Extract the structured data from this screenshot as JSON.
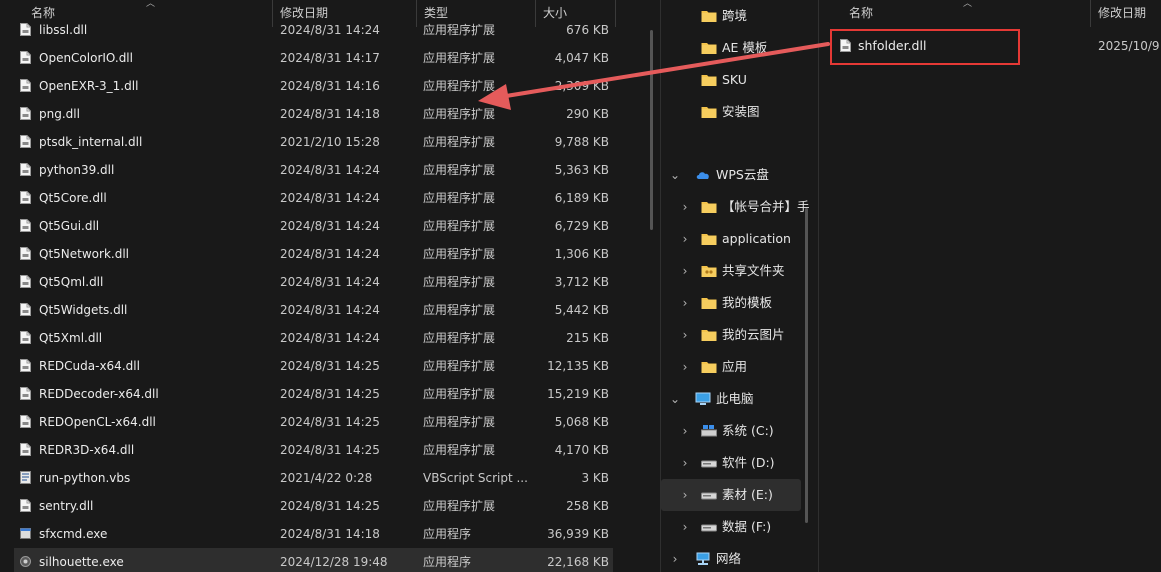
{
  "left_pane": {
    "columns": {
      "name": "名称",
      "date": "修改日期",
      "type": "类型",
      "size": "大小"
    },
    "rows": [
      {
        "name": "libssl.dll",
        "date": "2024/8/31 14:24",
        "type": "应用程序扩展",
        "size": "676 KB",
        "icon": "dll-file-icon"
      },
      {
        "name": "OpenColorIO.dll",
        "date": "2024/8/31 14:17",
        "type": "应用程序扩展",
        "size": "4,047 KB",
        "icon": "dll-file-icon"
      },
      {
        "name": "OpenEXR-3_1.dll",
        "date": "2024/8/31 14:16",
        "type": "应用程序扩展",
        "size": "2,309 KB",
        "icon": "dll-file-icon"
      },
      {
        "name": "png.dll",
        "date": "2024/8/31 14:18",
        "type": "应用程序扩展",
        "size": "290 KB",
        "icon": "dll-file-icon"
      },
      {
        "name": "ptsdk_internal.dll",
        "date": "2021/2/10 15:28",
        "type": "应用程序扩展",
        "size": "9,788 KB",
        "icon": "dll-file-icon"
      },
      {
        "name": "python39.dll",
        "date": "2024/8/31 14:24",
        "type": "应用程序扩展",
        "size": "5,363 KB",
        "icon": "dll-file-icon"
      },
      {
        "name": "Qt5Core.dll",
        "date": "2024/8/31 14:24",
        "type": "应用程序扩展",
        "size": "6,189 KB",
        "icon": "dll-file-icon"
      },
      {
        "name": "Qt5Gui.dll",
        "date": "2024/8/31 14:24",
        "type": "应用程序扩展",
        "size": "6,729 KB",
        "icon": "dll-file-icon"
      },
      {
        "name": "Qt5Network.dll",
        "date": "2024/8/31 14:24",
        "type": "应用程序扩展",
        "size": "1,306 KB",
        "icon": "dll-file-icon"
      },
      {
        "name": "Qt5Qml.dll",
        "date": "2024/8/31 14:24",
        "type": "应用程序扩展",
        "size": "3,712 KB",
        "icon": "dll-file-icon"
      },
      {
        "name": "Qt5Widgets.dll",
        "date": "2024/8/31 14:24",
        "type": "应用程序扩展",
        "size": "5,442 KB",
        "icon": "dll-file-icon"
      },
      {
        "name": "Qt5Xml.dll",
        "date": "2024/8/31 14:24",
        "type": "应用程序扩展",
        "size": "215 KB",
        "icon": "dll-file-icon"
      },
      {
        "name": "REDCuda-x64.dll",
        "date": "2024/8/31 14:25",
        "type": "应用程序扩展",
        "size": "12,135 KB",
        "icon": "dll-file-icon"
      },
      {
        "name": "REDDecoder-x64.dll",
        "date": "2024/8/31 14:25",
        "type": "应用程序扩展",
        "size": "15,219 KB",
        "icon": "dll-file-icon"
      },
      {
        "name": "REDOpenCL-x64.dll",
        "date": "2024/8/31 14:25",
        "type": "应用程序扩展",
        "size": "5,068 KB",
        "icon": "dll-file-icon"
      },
      {
        "name": "REDR3D-x64.dll",
        "date": "2024/8/31 14:25",
        "type": "应用程序扩展",
        "size": "4,170 KB",
        "icon": "dll-file-icon"
      },
      {
        "name": "run-python.vbs",
        "date": "2021/4/22 0:28",
        "type": "VBScript Script ...",
        "size": "3 KB",
        "icon": "vbs-script-icon"
      },
      {
        "name": "sentry.dll",
        "date": "2024/8/31 14:25",
        "type": "应用程序扩展",
        "size": "258 KB",
        "icon": "dll-file-icon"
      },
      {
        "name": "sfxcmd.exe",
        "date": "2024/8/31 14:18",
        "type": "应用程序",
        "size": "36,939 KB",
        "icon": "exe-file-icon"
      },
      {
        "name": "silhouette.exe",
        "date": "2024/12/28 19:48",
        "type": "应用程序",
        "size": "22,168 KB",
        "icon": "app-exe-icon",
        "selected": true
      }
    ]
  },
  "nav": {
    "items": [
      {
        "label": "跨境",
        "icon": "folder-icon",
        "indent": 1,
        "chevron": ""
      },
      {
        "label": "AE 模板",
        "icon": "folder-icon",
        "indent": 1,
        "chevron": ""
      },
      {
        "label": "SKU",
        "icon": "folder-icon",
        "indent": 1,
        "chevron": ""
      },
      {
        "label": "安装图",
        "icon": "folder-icon",
        "indent": 1,
        "chevron": ""
      },
      {
        "label": "WPS云盘",
        "icon": "cloud-icon",
        "indent": 0,
        "chevron": "expanded"
      },
      {
        "label": "【帐号合并】手",
        "icon": "folder-icon",
        "indent": 1,
        "chevron": "collapsed"
      },
      {
        "label": "application",
        "icon": "folder-icon",
        "indent": 1,
        "chevron": "collapsed"
      },
      {
        "label": "共享文件夹",
        "icon": "shared-folder-icon",
        "indent": 1,
        "chevron": "collapsed"
      },
      {
        "label": "我的模板",
        "icon": "folder-icon",
        "indent": 1,
        "chevron": "collapsed"
      },
      {
        "label": "我的云图片",
        "icon": "folder-icon",
        "indent": 1,
        "chevron": "collapsed"
      },
      {
        "label": "应用",
        "icon": "folder-icon",
        "indent": 1,
        "chevron": "collapsed"
      },
      {
        "label": "此电脑",
        "icon": "computer-icon",
        "indent": 0,
        "chevron": "expanded"
      },
      {
        "label": "系统 (C:)",
        "icon": "system-drive-icon",
        "indent": 1,
        "chevron": "collapsed"
      },
      {
        "label": "软件 (D:)",
        "icon": "drive-icon",
        "indent": 1,
        "chevron": "collapsed"
      },
      {
        "label": "素材 (E:)",
        "icon": "drive-icon",
        "indent": 1,
        "chevron": "collapsed",
        "selected": true
      },
      {
        "label": "数据 (F:)",
        "icon": "drive-icon",
        "indent": 1,
        "chevron": "collapsed"
      },
      {
        "label": "网络",
        "icon": "network-icon",
        "indent": 0,
        "chevron": "collapsed"
      }
    ]
  },
  "right_pane": {
    "columns": {
      "name": "名称",
      "date": "修改日期"
    },
    "file": {
      "name": "shfolder.dll",
      "date": "2025/10/9",
      "icon": "dll-file-icon"
    }
  },
  "colors": {
    "annotation_red": "#e53935",
    "folder_yellow": "#f3c34b",
    "background": "#191919",
    "selection": "#2e2e2e"
  }
}
